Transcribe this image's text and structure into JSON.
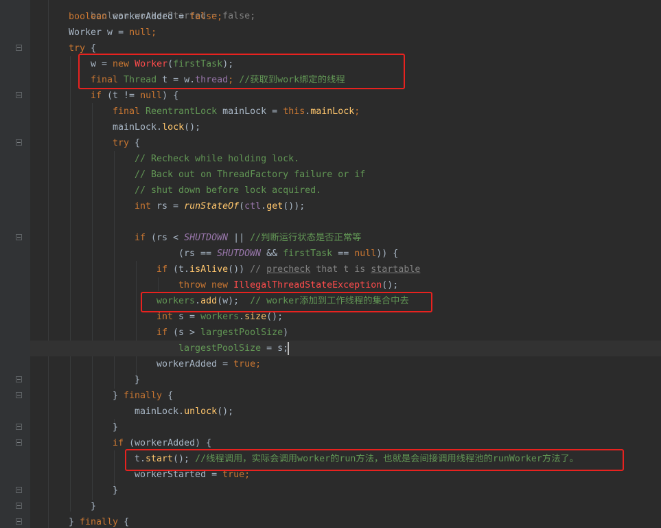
{
  "code": {
    "l1": "boolean workerStarted = false;",
    "l2": [
      "boolean",
      " workerAdded = ",
      "false",
      ";"
    ],
    "l3": [
      "Worker",
      " w = ",
      "null",
      ";"
    ],
    "l4": [
      "try",
      " {"
    ],
    "l5": [
      "w = ",
      "new ",
      "Worker",
      "(",
      "firstTask",
      ");"
    ],
    "l6": [
      "final ",
      "Thread",
      " t = w.",
      "thread",
      "; ",
      "//获取到work绑定的线程"
    ],
    "l7": [
      "if ",
      "(t != ",
      "null",
      ") {"
    ],
    "l8": [
      "final ",
      "ReentrantLock",
      " mainLock = ",
      "this",
      ".",
      "mainLock",
      ";"
    ],
    "l9": [
      "mainLock.",
      "lock",
      "();"
    ],
    "l10": [
      "try",
      " {"
    ],
    "l11": "// Recheck while holding lock.",
    "l12": "// Back out on ThreadFactory failure or if",
    "l13": "// shut down before lock acquired.",
    "l14": [
      "int ",
      "rs = ",
      "runStateOf",
      "(",
      "ctl",
      ".",
      "get",
      "());"
    ],
    "l15": [
      "if ",
      "(rs < ",
      "SHUTDOWN",
      " || ",
      "//判断运行状态是否正常等"
    ],
    "l16": [
      "(rs == ",
      "SHUTDOWN",
      " && ",
      "firstTask",
      " == ",
      "null",
      ")) {"
    ],
    "l17": [
      "if ",
      "(t.",
      "isAlive",
      "()) ",
      "// ",
      "precheck",
      " that t is ",
      "startable"
    ],
    "l18": [
      "throw new ",
      "IllegalThreadStateException",
      "();"
    ],
    "l19": [
      "workers",
      ".",
      "add",
      "(w);  ",
      "// worker添加到工作线程的集合中去"
    ],
    "l20": [
      "int ",
      "s = ",
      "workers",
      ".",
      "size",
      "();"
    ],
    "l21": [
      "if ",
      "(s > ",
      "largestPoolSize",
      ")"
    ],
    "l22": [
      "largestPoolSize",
      " = s;"
    ],
    "l23": [
      "workerAdded",
      " = ",
      "true",
      ";"
    ],
    "l24": "}",
    "l25": [
      "} ",
      "finally",
      " {"
    ],
    "l26": [
      "mainLock.",
      "unlock",
      "();"
    ],
    "l27": "}",
    "l28": [
      "if ",
      "(workerAdded) {"
    ],
    "l29": [
      "t.",
      "start",
      "(); ",
      "//线程调用，实际会调用worker的run方法，也就是会间接调用线程池的runWorker方法了。"
    ],
    "l30": [
      "workerStarted",
      " = ",
      "true",
      ";"
    ],
    "l31": "}",
    "l32": "}",
    "l33": [
      "} ",
      "finally",
      " {"
    ]
  },
  "colors": {
    "background": "#2b2b2b",
    "keyword": "#cc7832",
    "comment": "#629755",
    "highlight_box": "#e8221f"
  }
}
